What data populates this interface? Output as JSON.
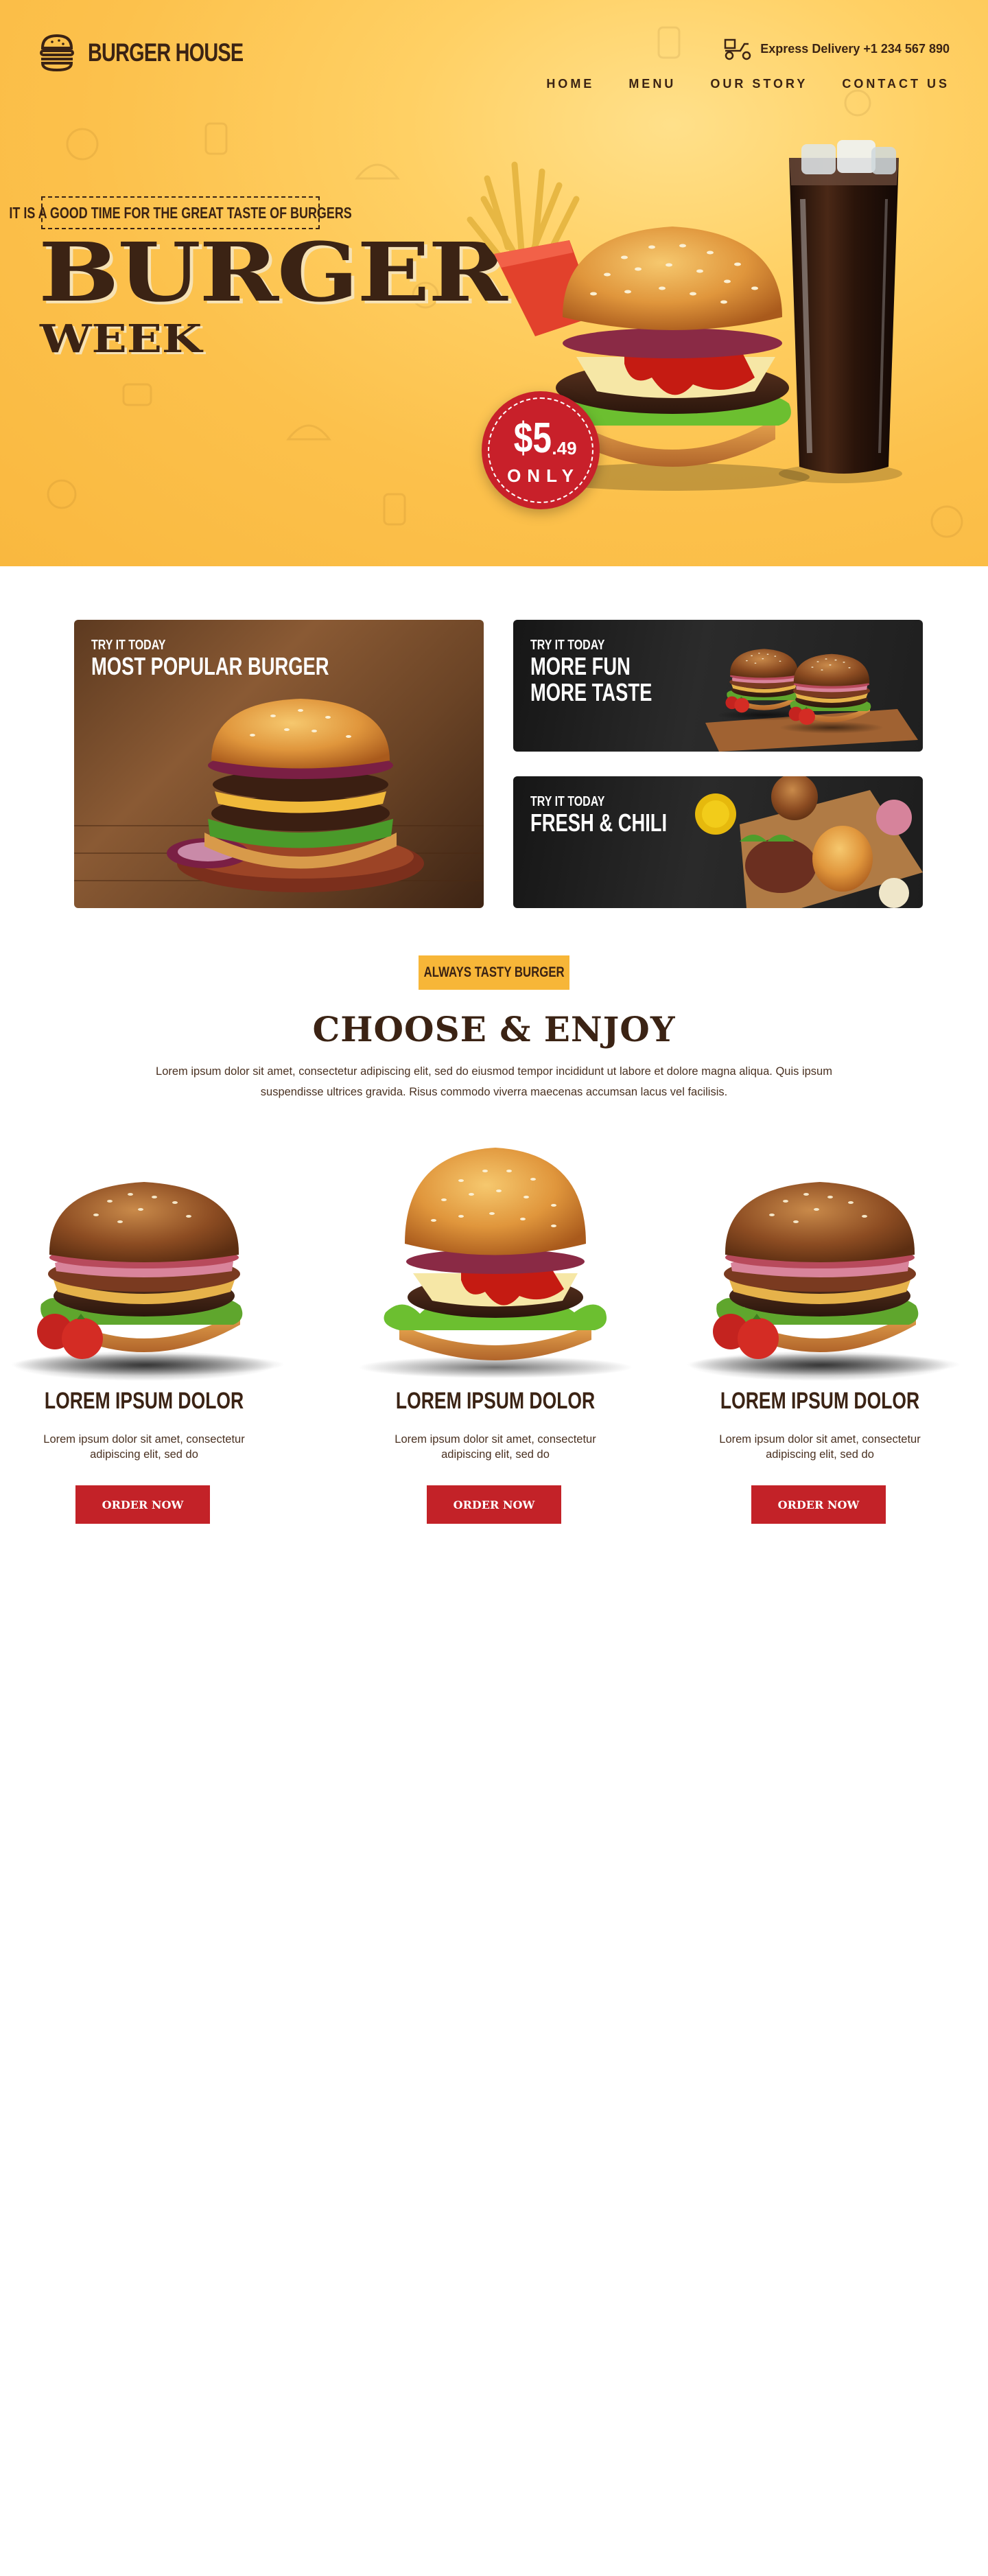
{
  "brand": {
    "name": "BURGER HOUSE"
  },
  "header": {
    "delivery": "Express Delivery +1 234 567 890",
    "nav": [
      "HOME",
      "MENU",
      "OUR STORY",
      "CONTACT US"
    ]
  },
  "hero": {
    "tagline": "IT IS A GOOD TIME FOR THE GREAT TASTE OF BURGERS",
    "title": "BURGER",
    "subtitle": "WEEK",
    "price_main": "$5",
    "price_cents": ".49",
    "price_note": "ONLY"
  },
  "promos": [
    {
      "kicker": "TRY IT TODAY",
      "title": "MOST POPULAR BURGER"
    },
    {
      "kicker": "TRY IT TODAY",
      "title": "MORE FUN\nMORE TASTE"
    },
    {
      "kicker": "TRY IT TODAY",
      "title": "FRESH & CHILI"
    }
  ],
  "section": {
    "tag": "ALWAYS TASTY BURGER",
    "title": "CHOOSE & ENJOY",
    "description": "Lorem ipsum dolor sit amet, consectetur adipiscing elit, sed do eiusmod tempor incididunt ut labore et dolore magna aliqua. Quis ipsum suspendisse ultrices gravida. Risus commodo viverra maecenas accumsan lacus vel facilisis."
  },
  "products": [
    {
      "name": "LOREM IPSUM DOLOR",
      "description": "Lorem ipsum dolor sit amet, consectetur adipiscing elit, sed do",
      "button": "ORDER NOW"
    },
    {
      "name": "LOREM IPSUM DOLOR",
      "description": "Lorem ipsum dolor sit amet, consectetur adipiscing elit, sed do",
      "button": "ORDER NOW"
    },
    {
      "name": "LOREM IPSUM DOLOR",
      "description": "Lorem ipsum dolor sit amet, consectetur adipiscing elit, sed do",
      "button": "ORDER NOW"
    }
  ],
  "colors": {
    "brown": "#3b2314",
    "yellow": "#fcc14c",
    "red": "#c32228",
    "tag_yellow": "#f7b638"
  },
  "icons": {
    "logo": "burger-icon",
    "delivery": "delivery-scooter-icon"
  }
}
